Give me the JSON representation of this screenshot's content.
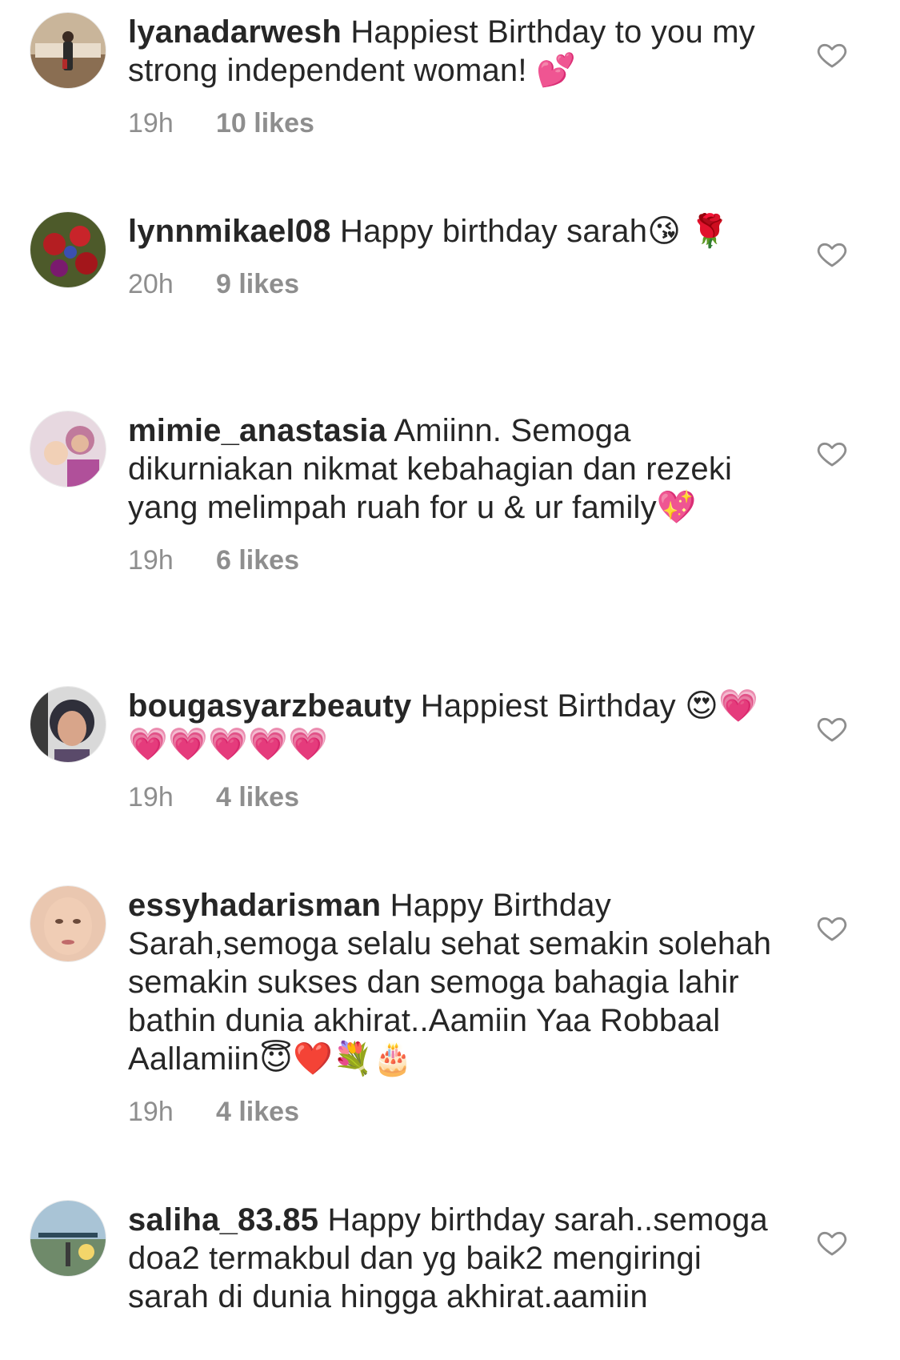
{
  "comments": [
    {
      "username": "lyanadarwesh",
      "text": "Happiest Birthday to you my strong independent woman! 💕",
      "time": "19h",
      "likes": "10 likes"
    },
    {
      "username": "lynnmikael08",
      "text": "Happy birthday sarah😘 🌹",
      "time": "20h",
      "likes": "9 likes"
    },
    {
      "username": "mimie_anastasia",
      "text": "Amiinn. Semoga dikurniakan nikmat kebahagian dan rezeki yang melimpah ruah for u & ur family💖",
      "time": "19h",
      "likes": "6 likes"
    },
    {
      "username": "bougasyarzbeauty",
      "text": "Happiest Birthday 😍💗💗💗💗💗💗",
      "time": "19h",
      "likes": "4 likes"
    },
    {
      "username": "essyhadarisman",
      "text": "Happy Birthday Sarah,semoga selalu sehat semakin solehah semakin sukses dan semoga bahagia lahir bathin dunia akhirat..Aamiin Yaa Robbaal Aallamiin😇❤️💐🎂",
      "time": "19h",
      "likes": "4 likes"
    },
    {
      "username": "saliha_83.85",
      "text": "Happy birthday sarah..semoga doa2 termakbul dan yg baik2 mengiringi sarah di dunia hingga akhirat.aamiin",
      "time": "",
      "likes": ""
    }
  ],
  "icons": {
    "heart": "heart-outline-icon",
    "avatar": "avatar"
  },
  "colors": {
    "text": "#262626",
    "meta": "#8e8e8e",
    "heart_stroke": "#8e8e8e"
  }
}
